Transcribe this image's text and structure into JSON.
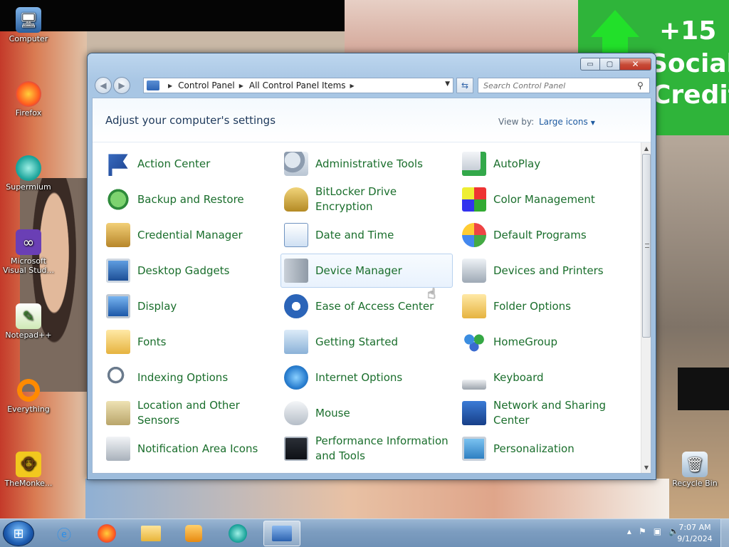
{
  "desktop": {
    "icons": [
      {
        "label": "Computer"
      },
      {
        "label": "Firefox"
      },
      {
        "label": "Supermium"
      },
      {
        "label": "Microsoft Visual Stud..."
      },
      {
        "label": "Notepad++"
      },
      {
        "label": "Everything"
      },
      {
        "label": "TheMonke..."
      },
      {
        "label": "Recycle Bin"
      }
    ],
    "wallpaper_text": [
      "+15",
      "Social",
      "Credit"
    ]
  },
  "window": {
    "controls": {
      "minimize": "▭",
      "maximize": "▢",
      "close": "✕"
    },
    "nav": {
      "back": "◀",
      "forward": "▶"
    },
    "breadcrumb": [
      "Control Panel",
      "All Control Panel Items"
    ],
    "search_placeholder": "Search Control Panel",
    "heading": "Adjust your computer's settings",
    "view_by_label": "View by:",
    "view_by_value": "Large icons",
    "items": [
      {
        "label": "Action Center",
        "icon": "flag-icon"
      },
      {
        "label": "Administrative Tools",
        "icon": "admin-tools-icon"
      },
      {
        "label": "AutoPlay",
        "icon": "autoplay-icon"
      },
      {
        "label": "Backup and Restore",
        "icon": "backup-icon"
      },
      {
        "label": "BitLocker Drive Encryption",
        "icon": "bitlocker-icon"
      },
      {
        "label": "Color Management",
        "icon": "color-management-icon"
      },
      {
        "label": "Credential Manager",
        "icon": "credential-icon"
      },
      {
        "label": "Date and Time",
        "icon": "calendar-clock-icon"
      },
      {
        "label": "Default Programs",
        "icon": "default-programs-icon"
      },
      {
        "label": "Desktop Gadgets",
        "icon": "gadgets-icon"
      },
      {
        "label": "Device Manager",
        "icon": "device-manager-icon"
      },
      {
        "label": "Devices and Printers",
        "icon": "printer-icon"
      },
      {
        "label": "Display",
        "icon": "monitor-icon"
      },
      {
        "label": "Ease of Access Center",
        "icon": "accessibility-icon"
      },
      {
        "label": "Folder Options",
        "icon": "folder-options-icon"
      },
      {
        "label": "Fonts",
        "icon": "fonts-icon"
      },
      {
        "label": "Getting Started",
        "icon": "getting-started-icon"
      },
      {
        "label": "HomeGroup",
        "icon": "homegroup-icon"
      },
      {
        "label": "Indexing Options",
        "icon": "indexing-icon"
      },
      {
        "label": "Internet Options",
        "icon": "internet-options-icon"
      },
      {
        "label": "Keyboard",
        "icon": "keyboard-icon"
      },
      {
        "label": "Location and Other Sensors",
        "icon": "sensors-icon"
      },
      {
        "label": "Mouse",
        "icon": "mouse-icon"
      },
      {
        "label": "Network and Sharing Center",
        "icon": "network-icon"
      },
      {
        "label": "Notification Area Icons",
        "icon": "notification-icon"
      },
      {
        "label": "Performance Information and Tools",
        "icon": "performance-icon"
      },
      {
        "label": "Personalization",
        "icon": "personalization-icon"
      }
    ],
    "hovered_item": "Device Manager"
  },
  "taskbar": {
    "apps": [
      "Internet Explorer",
      "Firefox",
      "Windows Explorer",
      "Media Player",
      "Supermium",
      "Control Panel"
    ],
    "clock": {
      "time": "7:07 AM",
      "date": "9/1/2024"
    }
  },
  "colors": {
    "link_green": "#1a6e2c",
    "heading_blue": "#1e395b",
    "accent_blue": "#1e5aa0"
  }
}
